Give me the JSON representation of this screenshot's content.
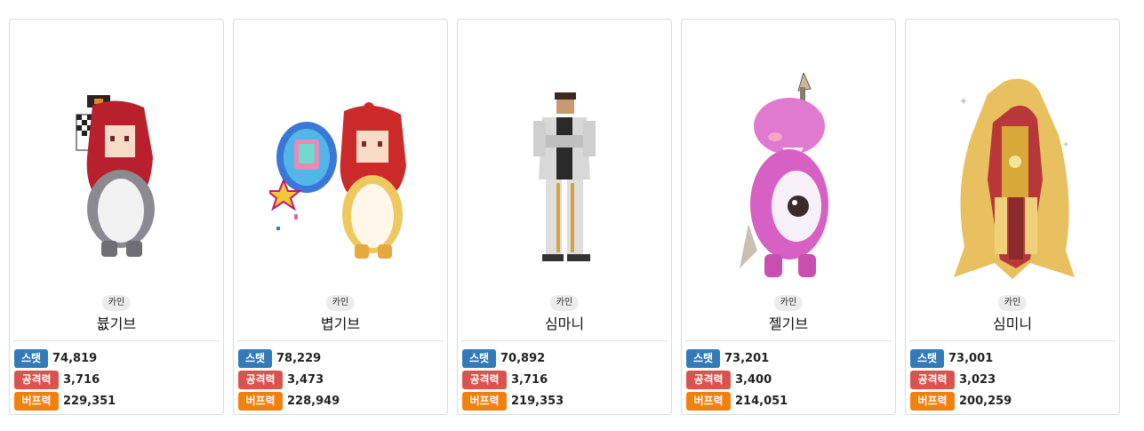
{
  "colors": {
    "stat": "#337ab7",
    "attack": "#d9534f",
    "buff": "#f0810f"
  },
  "characters": [
    {
      "server": "카인",
      "name": "븂기브",
      "stat_label": "스탯",
      "stat": "74,819",
      "attack_label": "공격력",
      "attack": "3,716",
      "buff_label": "버프력",
      "buff": "229,351",
      "art": "red-hair-mascot-costume"
    },
    {
      "server": "카인",
      "name": "볍기브",
      "stat_label": "스탯",
      "stat": "78,229",
      "attack_label": "공격력",
      "attack": "3,473",
      "buff_label": "버프력",
      "buff": "228,949",
      "art": "red-hair-with-magic-mirror"
    },
    {
      "server": "카인",
      "name": "심마니",
      "stat_label": "스탯",
      "stat": "70,892",
      "attack_label": "공격력",
      "attack": "3,716",
      "buff_label": "버프력",
      "buff": "219,353",
      "art": "man-in-white-suit"
    },
    {
      "server": "카인",
      "name": "젤기브",
      "stat_label": "스탯",
      "stat": "73,201",
      "attack_label": "공격력",
      "attack": "3,400",
      "buff_label": "버프력",
      "buff": "214,051",
      "art": "pink-fish-mascot"
    },
    {
      "server": "카인",
      "name": "심미니",
      "stat_label": "스탯",
      "stat": "73,001",
      "attack_label": "공격력",
      "attack": "3,023",
      "buff_label": "버프력",
      "buff": "200,259",
      "art": "golden-feathered-armor"
    }
  ]
}
